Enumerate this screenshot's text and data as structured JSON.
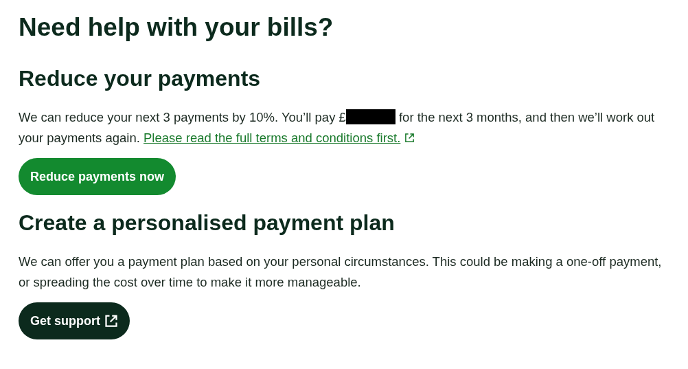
{
  "title": "Need help with your bills?",
  "sections": [
    {
      "heading": "Reduce your payments",
      "text_before": "We can reduce your next 3 payments by 10%. You’ll pay £",
      "redacted": true,
      "text_after": " for the next 3 months, and then we’ll work out your payments again. ",
      "link": {
        "label": "Please read the full terms and conditions first.",
        "external": true
      },
      "button": {
        "label": "Reduce payments now",
        "kind": "primary",
        "external": false
      }
    },
    {
      "heading": "Create a personalised payment plan",
      "text_before": "We can offer you a payment plan based on your personal circumstances. This could be making a one-off payment, or spreading the cost over time to make it more manageable.",
      "button": {
        "label": "Get support",
        "kind": "secondary",
        "external": true
      }
    }
  ]
}
